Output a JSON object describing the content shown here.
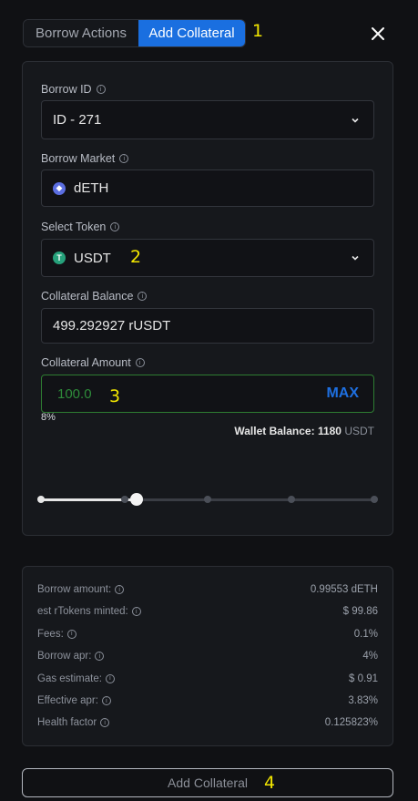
{
  "tabs": {
    "borrow_actions": "Borrow Actions",
    "add_collateral": "Add Collateral"
  },
  "callouts": {
    "c1": "1",
    "c2": "2",
    "c3": "3",
    "c4": "4"
  },
  "form": {
    "borrow_id_label": "Borrow ID",
    "borrow_id_value": "ID - 271",
    "borrow_market_label": "Borrow Market",
    "borrow_market_value": "dETH",
    "select_token_label": "Select Token",
    "select_token_value": "USDT",
    "collateral_balance_label": "Collateral Balance",
    "collateral_balance_value": "499.292927 rUSDT",
    "collateral_amount_label": "Collateral Amount",
    "collateral_amount_value": "100.0",
    "max_label": "MAX",
    "wallet_balance_label": "Wallet Balance:",
    "wallet_balance_value": "1180",
    "wallet_balance_unit": "USDT"
  },
  "slider": {
    "percent_label": "8%",
    "value_fraction": 0.08
  },
  "summary": [
    {
      "label": "Borrow amount:",
      "value": "0.99553 dETH"
    },
    {
      "label": "est rTokens minted:",
      "value": "$ 99.86"
    },
    {
      "label": "Fees:",
      "value": "0.1%"
    },
    {
      "label": "Borrow apr:",
      "value": "4%"
    },
    {
      "label": "Gas estimate:",
      "value": "$ 0.91"
    },
    {
      "label": "Effective apr:",
      "value": "3.83%"
    },
    {
      "label": "Health factor",
      "value": "0.125823%"
    }
  ],
  "submit_label": "Add Collateral",
  "icons": {
    "close": "close-icon",
    "info": "info-icon",
    "chevron": "chevron-down-icon",
    "eth": "ethereum-icon",
    "usdt": "tether-icon"
  },
  "colors": {
    "accent": "#1a6fe0",
    "amount_border": "#2e7d32",
    "amount_text": "#2e8b3a",
    "background": "#101114"
  }
}
